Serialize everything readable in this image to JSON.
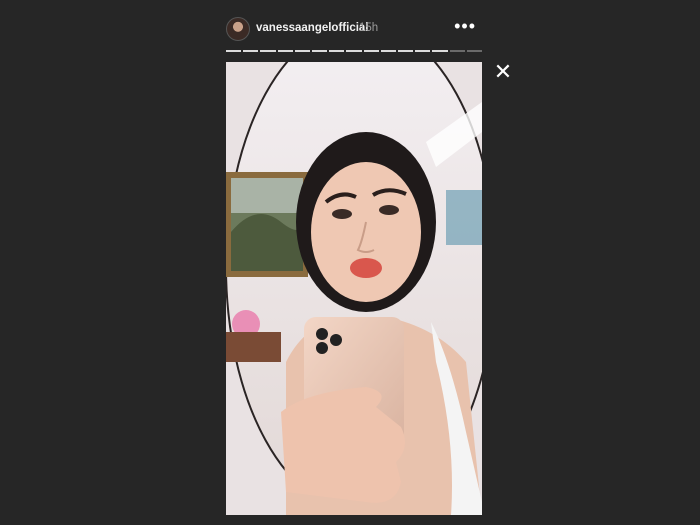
{
  "header": {
    "username": "vanessaangelofficial",
    "time": "15h",
    "more_glyph": "•••"
  },
  "progress": {
    "segments": 15,
    "active": 13
  },
  "close_glyph": "✕",
  "icons": {
    "more": "more-options-icon",
    "close": "close-icon"
  }
}
